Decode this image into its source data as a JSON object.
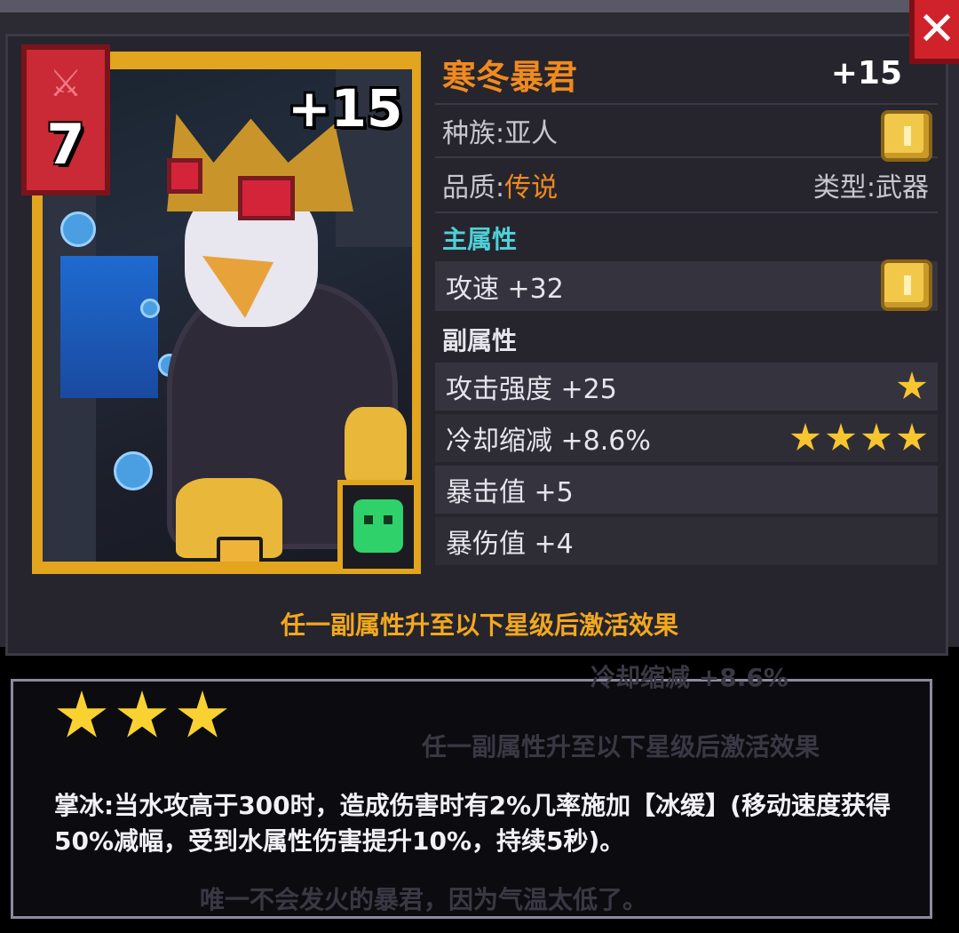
{
  "close_label": "✕",
  "card": {
    "level": "7",
    "enhance": "+15",
    "weapon_icon": "sword-icon",
    "slot_icon": "green-slime-icon"
  },
  "item": {
    "name": "寒冬暴君",
    "enhance": "+15",
    "race": "种族:亚人",
    "quality_label": "品质:",
    "quality_value": "传说",
    "type": "类型:武器"
  },
  "main_attr": {
    "header": "主属性",
    "stat": "攻速 +32"
  },
  "sub_attr": {
    "header": "副属性",
    "stats": [
      {
        "text": "攻击强度 +25",
        "stars": 1
      },
      {
        "text": "冷却缩减 +8.6%",
        "stars": 4
      },
      {
        "text": "暴击值 +5",
        "stars": 0
      },
      {
        "text": "暴伤值 +4",
        "stars": 0
      }
    ]
  },
  "activate_hint": "任一副属性升至以下星级后激活效果",
  "tooltip": {
    "stars": 3,
    "effect_text": "掌冰:当水攻高于300时，造成伤害时有2%几率施加【冰缓】(移动速度获得50%减幅，受到水属性伤害提升10%，持续5秒)。",
    "bg_ghost_1": "冷却缩减 +8.6%",
    "bg_ghost_2": "任一副属性升至以下星级后激活效果",
    "bg_ghost_3": "唯一不会发火的暴君，因为气温太低了。"
  },
  "colors": {
    "accent_orange": "#f08a1f",
    "teal": "#4fd0d9",
    "gold_frame": "#e3a41e",
    "red_badge": "#c92a35"
  }
}
